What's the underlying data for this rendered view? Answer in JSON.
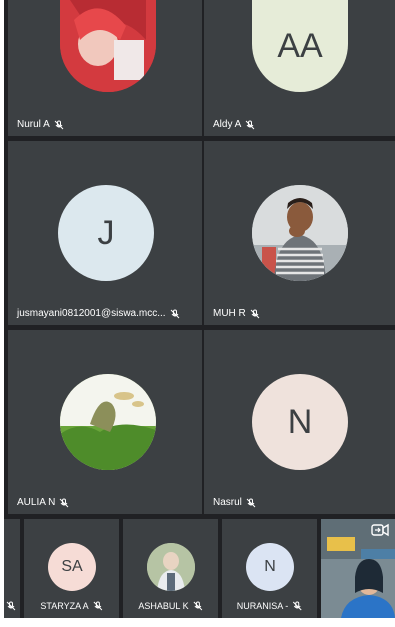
{
  "grid": [
    {
      "name": "Nurul A",
      "avatar_type": "photo",
      "photo_desc": "girl-red-hijab"
    },
    {
      "name": "Aldy A",
      "avatar_type": "initials",
      "initials": "AA",
      "avatar_color": "#e6ecd8"
    },
    {
      "name": "jusmayani0812001@siswa.mcc...",
      "avatar_type": "initials",
      "initials": "J",
      "avatar_color": "#dce8ee"
    },
    {
      "name": "MUH R",
      "avatar_type": "photo",
      "photo_desc": "boy-striped-shirt"
    },
    {
      "name": "AULIA N",
      "avatar_type": "photo",
      "photo_desc": "grass-field"
    },
    {
      "name": "Nasrul",
      "avatar_type": "initials",
      "initials": "N",
      "avatar_color": "#efe2dc"
    }
  ],
  "strip": [
    {
      "name": "STARYZA A",
      "initials": "SA",
      "avatar_color": "#f6dcd6"
    },
    {
      "name": "ASHABUL K",
      "avatar_type": "photo"
    },
    {
      "name": "NURANISA -",
      "initials": "N",
      "avatar_color": "#dbe4f3"
    }
  ],
  "icons": {
    "muted": "mic-off-icon",
    "self_view": "camera-switch-icon"
  }
}
